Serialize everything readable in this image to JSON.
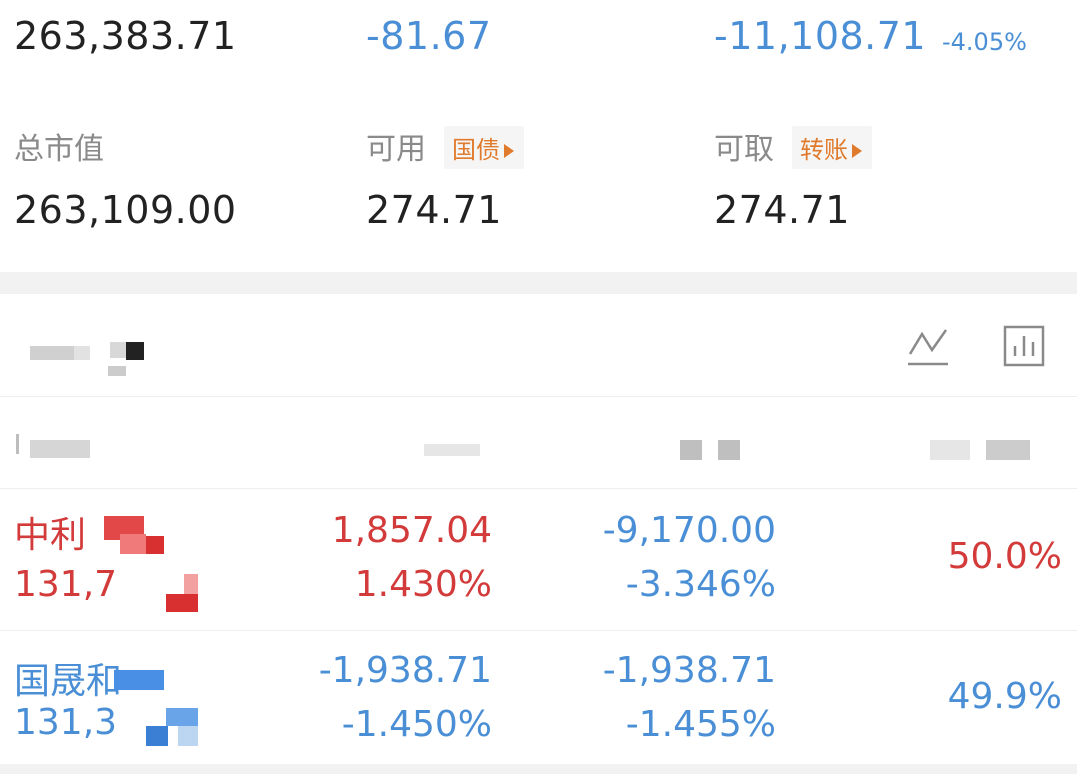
{
  "summary": {
    "total_assets": "263,383.71",
    "daily_pnl": "-81.67",
    "position_pnl": "-11,108.71",
    "position_pnl_pct": "-4.05%",
    "market_value_label": "总市值",
    "market_value": "263,109.00",
    "available_label": "可用",
    "available_tag": "国债",
    "available": "274.71",
    "withdrawable_label": "可取",
    "withdrawable_tag": "转账",
    "withdrawable": "274.71"
  },
  "holdings": {
    "icons": [
      "line-chart-icon",
      "bar-chart-icon"
    ],
    "rows": [
      {
        "name": "中利",
        "market_value": "131,7",
        "daily_pnl": "1,857.04",
        "daily_pnl_pct": "1.430%",
        "position_pnl": "-9,170.00",
        "position_pnl_pct": "-3.346%",
        "weight": "50.0%"
      },
      {
        "name": "国晟和",
        "market_value": "131,3",
        "daily_pnl": "-1,938.71",
        "daily_pnl_pct": "-1.450%",
        "position_pnl": "-1,938.71",
        "position_pnl_pct": "-1.455%",
        "weight": "49.9%"
      }
    ]
  },
  "colors": {
    "up": "#d33a3a",
    "down": "#4a8fd6",
    "accent": "#e07a2c"
  }
}
